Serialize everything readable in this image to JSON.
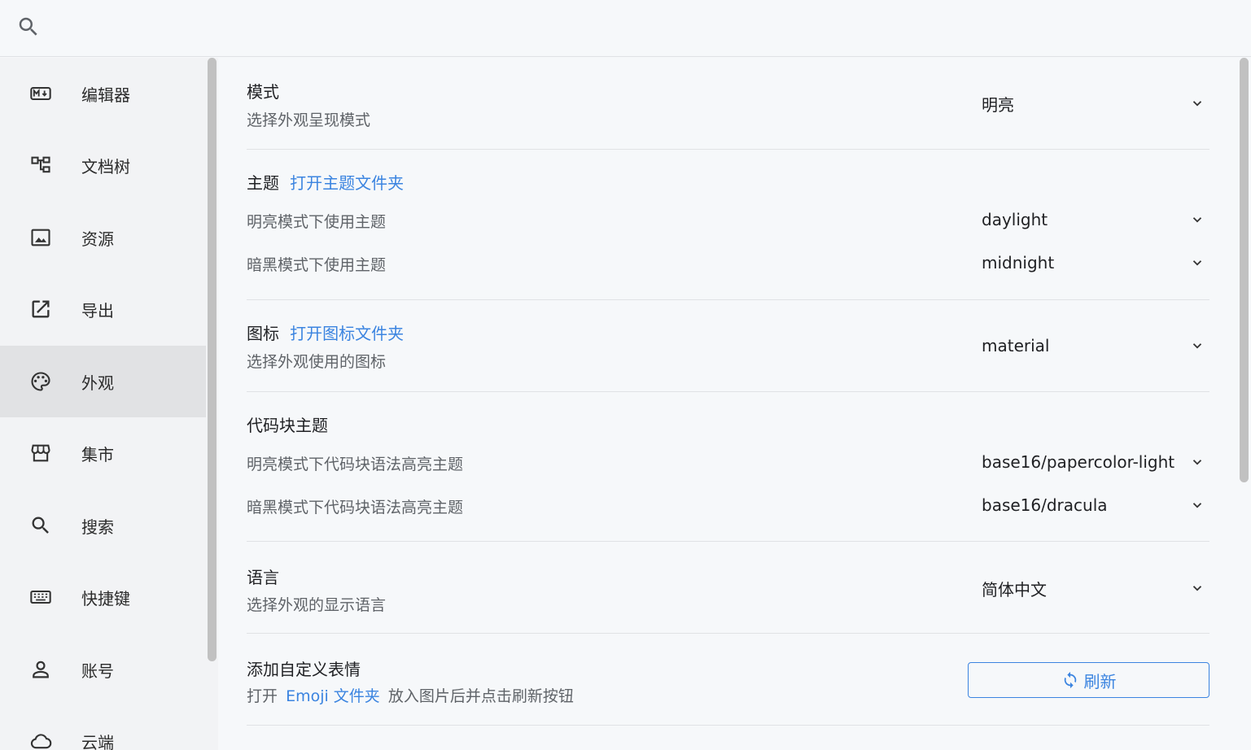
{
  "search": {
    "placeholder": ""
  },
  "sidebar": {
    "items": [
      {
        "label": "编辑器",
        "icon": "markdown-icon"
      },
      {
        "label": "文档树",
        "icon": "file-tree-icon"
      },
      {
        "label": "资源",
        "icon": "image-icon"
      },
      {
        "label": "导出",
        "icon": "export-icon"
      },
      {
        "label": "外观",
        "icon": "palette-icon",
        "active": true
      },
      {
        "label": "集市",
        "icon": "store-icon"
      },
      {
        "label": "搜索",
        "icon": "search-icon"
      },
      {
        "label": "快捷键",
        "icon": "keyboard-icon"
      },
      {
        "label": "账号",
        "icon": "account-icon"
      },
      {
        "label": "云端",
        "icon": "cloud-icon"
      }
    ]
  },
  "settings": {
    "mode": {
      "title": "模式",
      "desc": "选择外观呈现模式",
      "value": "明亮"
    },
    "theme": {
      "title": "主题",
      "link": "打开主题文件夹",
      "light_label": "明亮模式下使用主题",
      "light_value": "daylight",
      "dark_label": "暗黑模式下使用主题",
      "dark_value": "midnight"
    },
    "icon": {
      "title": "图标",
      "link": "打开图标文件夹",
      "desc": "选择外观使用的图标",
      "value": "material"
    },
    "codeblock": {
      "title": "代码块主题",
      "light_label": "明亮模式下代码块语法高亮主题",
      "light_value": "base16/papercolor-light",
      "dark_label": "暗黑模式下代码块语法高亮主题",
      "dark_value": "base16/dracula"
    },
    "language": {
      "title": "语言",
      "desc": "选择外观的显示语言",
      "value": "简体中文"
    },
    "emoji": {
      "title": "添加自定义表情",
      "desc_prefix": "打开",
      "desc_link": "Emoji 文件夹",
      "desc_suffix": "放入图片后并点击刷新按钮",
      "button": "刷新"
    }
  },
  "colors": {
    "accent": "#3b84e0",
    "active_bg": "#e1e2e4",
    "sidebar_bg": "#f2f3f5",
    "main_bg": "#f6f8fa"
  }
}
